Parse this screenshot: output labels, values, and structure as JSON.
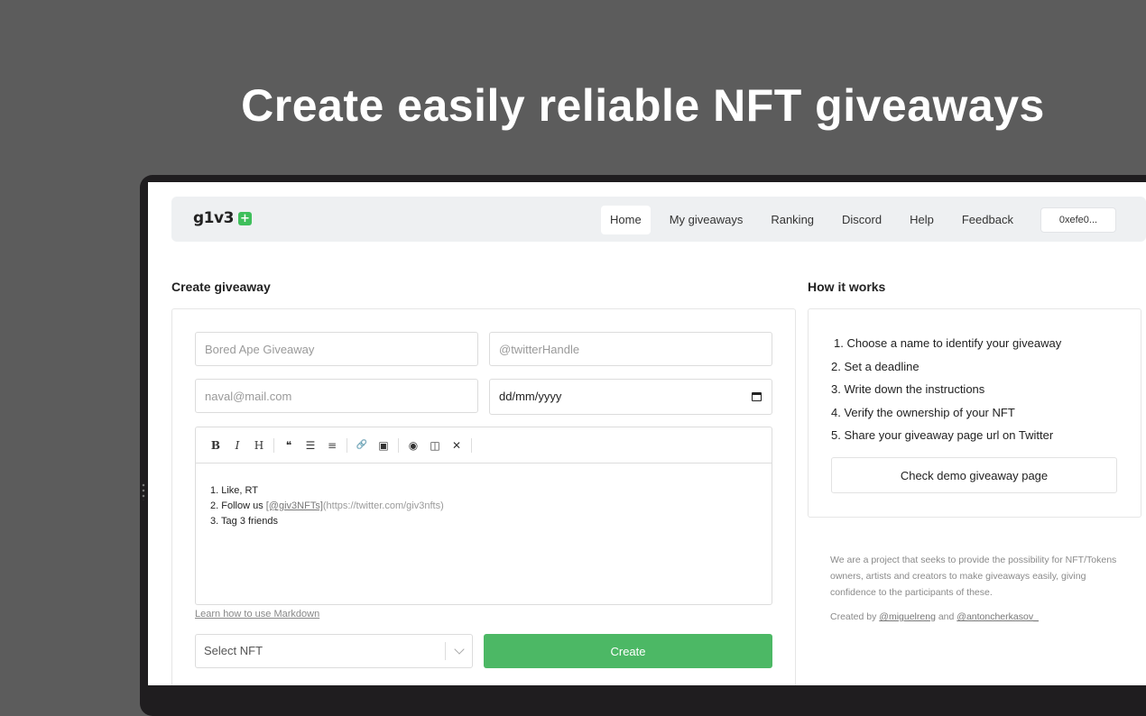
{
  "hero": {
    "title": "Create easily reliable NFT giveaways"
  },
  "navbar": {
    "logo": "g1v3",
    "logo_badge": "+",
    "links": [
      "Home",
      "My giveaways",
      "Ranking",
      "Discord",
      "Help",
      "Feedback"
    ],
    "active": "Home",
    "wallet": "0xefe0..."
  },
  "create": {
    "title": "Create giveaway",
    "name_placeholder": "Bored Ape Giveaway",
    "twitter_placeholder": "@twitterHandle",
    "email_placeholder": "naval@mail.com",
    "date_value": "dd/mm/yyyy",
    "toolbar": {
      "bold": "B",
      "italic": "I",
      "heading": "H",
      "quote": "❝",
      "unordered_list": "☰",
      "ordered_list": "≡",
      "link": "🔗",
      "image": "▣",
      "preview": "◉",
      "side_by_side": "◫",
      "fullscreen": "✕"
    },
    "editor": {
      "line1": "1. Like, RT",
      "line2_prefix": "2. Follow us ",
      "line2_link": "[@giv3NFTs]",
      "line2_url": "(https://twitter.com/giv3nfts)",
      "line3": "3. Tag 3 friends"
    },
    "markdown_help": "Learn how to use Markdown",
    "select_nft": "Select NFT",
    "create_button": "Create"
  },
  "how": {
    "title": "How it works",
    "steps": [
      "1. Choose a name to identify your giveaway",
      "2. Set a deadline",
      "3. Write down the instructions",
      "4. Verify the ownership of your NFT",
      "5. Share your giveaway page url on Twitter"
    ],
    "demo_button": "Check demo giveaway page",
    "about": "We are a project that seeks to provide the possibility for NFT/Tokens owners, artists and creators to make giveaways easily, giving confidence to the participants of these.",
    "created_by": "Created by",
    "author1": "@miguelreng",
    "and": "and",
    "author2": "@antoncherkasov_"
  }
}
